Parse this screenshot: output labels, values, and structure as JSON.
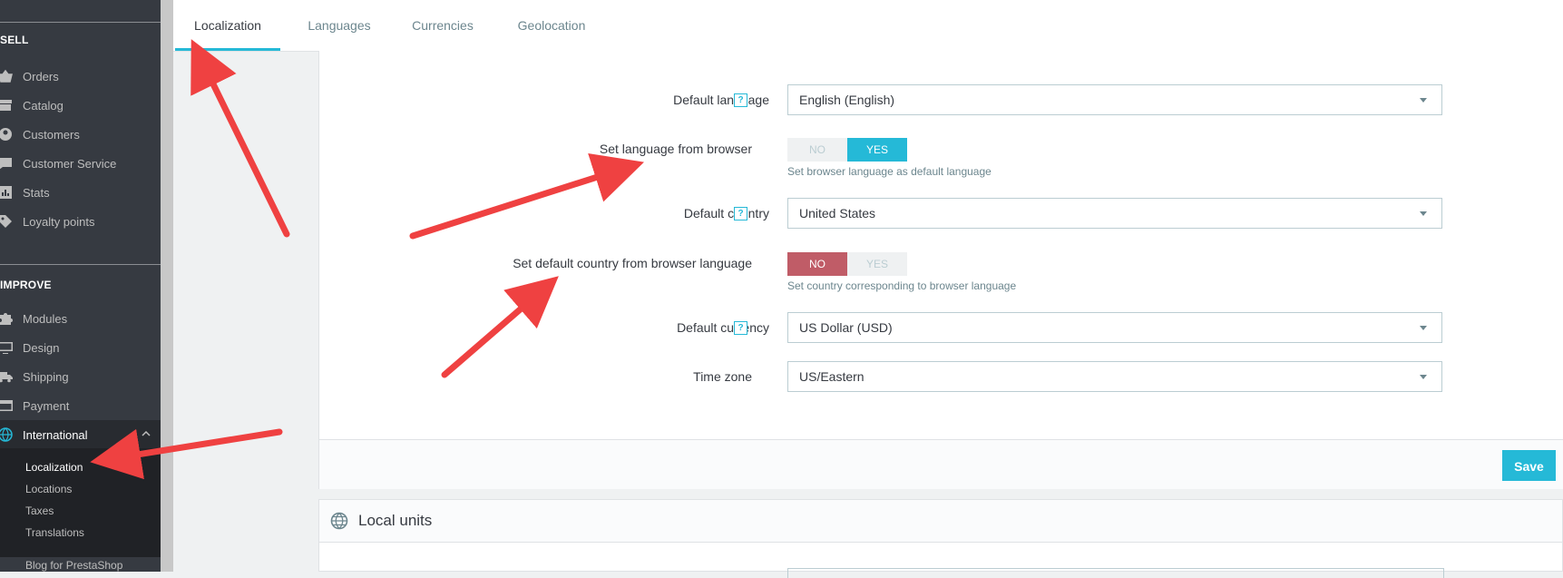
{
  "sidebar": {
    "sections": [
      "SELL",
      "IMPROVE"
    ],
    "sell_items": [
      {
        "label": "Orders",
        "icon": "basket-icon"
      },
      {
        "label": "Catalog",
        "icon": "store-icon"
      },
      {
        "label": "Customers",
        "icon": "user-icon"
      },
      {
        "label": "Customer Service",
        "icon": "chat-icon"
      },
      {
        "label": "Stats",
        "icon": "bar-chart-icon"
      },
      {
        "label": "Loyalty points",
        "icon": "tag-icon"
      }
    ],
    "improve_items": [
      {
        "label": "Modules",
        "icon": "puzzle-icon"
      },
      {
        "label": "Design",
        "icon": "monitor-icon"
      },
      {
        "label": "Shipping",
        "icon": "truck-icon"
      },
      {
        "label": "Payment",
        "icon": "credit-card-icon"
      },
      {
        "label": "International",
        "icon": "globe-icon"
      }
    ],
    "international_sub": [
      "Localization",
      "Locations",
      "Taxes",
      "Translations"
    ],
    "blog_item": "Blog for PrestaShop"
  },
  "tabs": [
    "Localization",
    "Languages",
    "Currencies",
    "Geolocation"
  ],
  "form": {
    "default_language": {
      "label": "Default language",
      "value": "English (English)"
    },
    "set_language_from_browser": {
      "label": "Set language from browser",
      "no": "NO",
      "yes": "YES",
      "hint": "Set browser language as default language"
    },
    "default_country": {
      "label": "Default country",
      "value": "United States"
    },
    "set_country_from_browser": {
      "label": "Set default country from browser language",
      "no": "NO",
      "yes": "YES",
      "hint": "Set country corresponding to browser language"
    },
    "default_currency": {
      "label": "Default currency",
      "value": "US Dollar (USD)"
    },
    "time_zone": {
      "label": "Time zone",
      "value": "US/Eastern"
    },
    "help_glyph": "?",
    "save_label": "Save"
  },
  "local_units": {
    "title": "Local units"
  },
  "colors": {
    "accent": "#25b9d7",
    "no_active": "#c05c67",
    "sidebar_bg": "#363a41",
    "arrow": "#ef4141"
  }
}
